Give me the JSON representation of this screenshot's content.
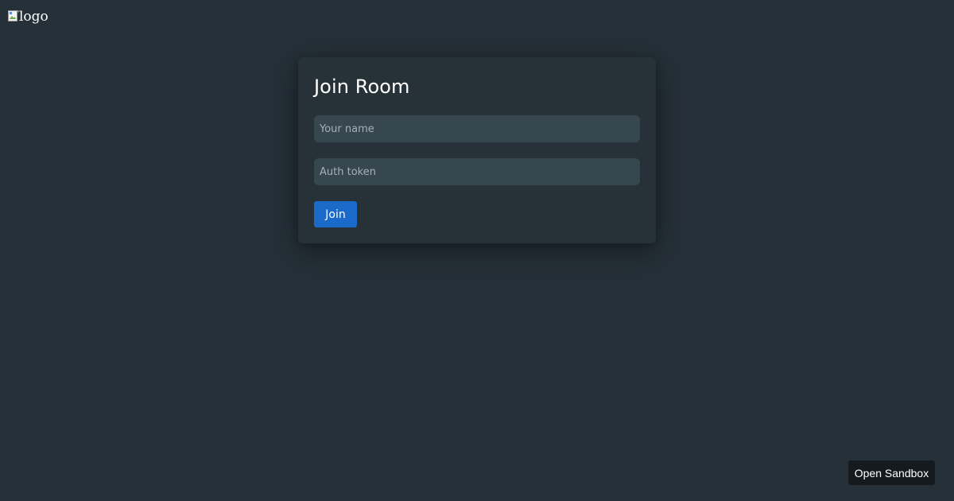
{
  "logo": {
    "alt_text": "logo",
    "icon": "broken-image-icon"
  },
  "join_form": {
    "title": "Join Room",
    "name_placeholder": "Your name",
    "name_value": "",
    "token_placeholder": "Auth token",
    "token_value": "",
    "join_label": "Join"
  },
  "footer": {
    "sandbox_label": "Open Sandbox"
  },
  "colors": {
    "background": "#263038",
    "card": "#263138",
    "input": "#37474f",
    "primary_button": "#1b6ac9",
    "sandbox_button": "#151a1e"
  }
}
